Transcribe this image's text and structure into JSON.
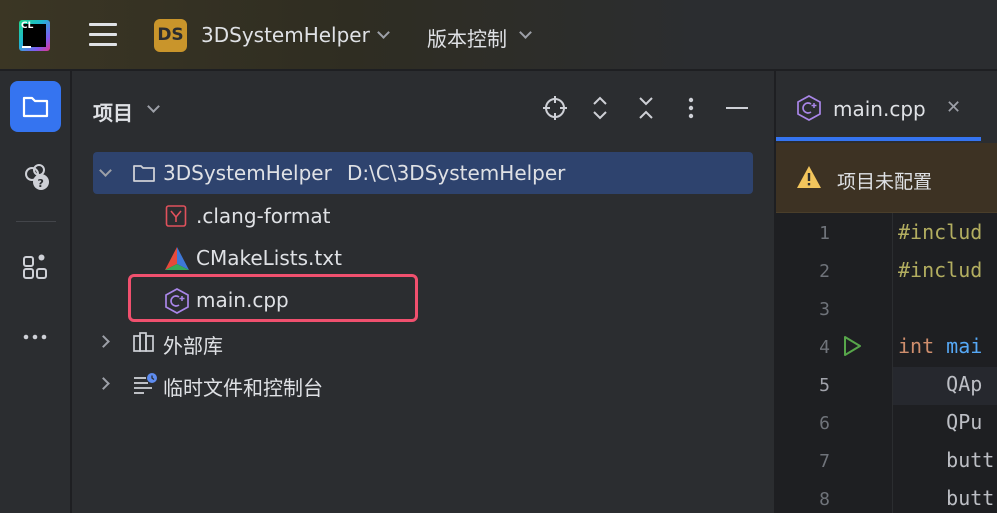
{
  "titlebar": {
    "logo_text": "CL",
    "project_badge": "DS",
    "project_name": "3DSystemHelper",
    "vcs_label": "版本控制"
  },
  "panel": {
    "title": "项目",
    "tree": [
      {
        "label": "3DSystemHelper",
        "path": "D:\\C\\3DSystemHelper",
        "icon": "folder-icon",
        "expanded": true,
        "selected": true
      },
      {
        "label": ".clang-format",
        "icon": "clang-format-icon"
      },
      {
        "label": "CMakeLists.txt",
        "icon": "cmake-icon"
      },
      {
        "label": "main.cpp",
        "icon": "cpp-file-icon",
        "highlighted": true
      },
      {
        "label": "外部库",
        "icon": "library-icon",
        "expanded": false
      },
      {
        "label": "临时文件和控制台",
        "icon": "scratches-icon",
        "expanded": false
      }
    ]
  },
  "editor": {
    "tab_label": "main.cpp",
    "warning": "项目未配置",
    "lines": [
      {
        "num": "1",
        "text": "#includ"
      },
      {
        "num": "2",
        "text": "#includ"
      },
      {
        "num": "3",
        "text": ""
      },
      {
        "num": "4",
        "kw": "int",
        "fn": " mai"
      },
      {
        "num": "5",
        "text": "    QAp"
      },
      {
        "num": "6",
        "text": "    QPu"
      },
      {
        "num": "7",
        "text": "    butt"
      },
      {
        "num": "8",
        "text": "    butt"
      }
    ]
  },
  "colors": {
    "accent": "#3574f0",
    "highlight_box": "#f0506e",
    "badge": "#c9952b",
    "warning_bg": "#3d3223"
  }
}
